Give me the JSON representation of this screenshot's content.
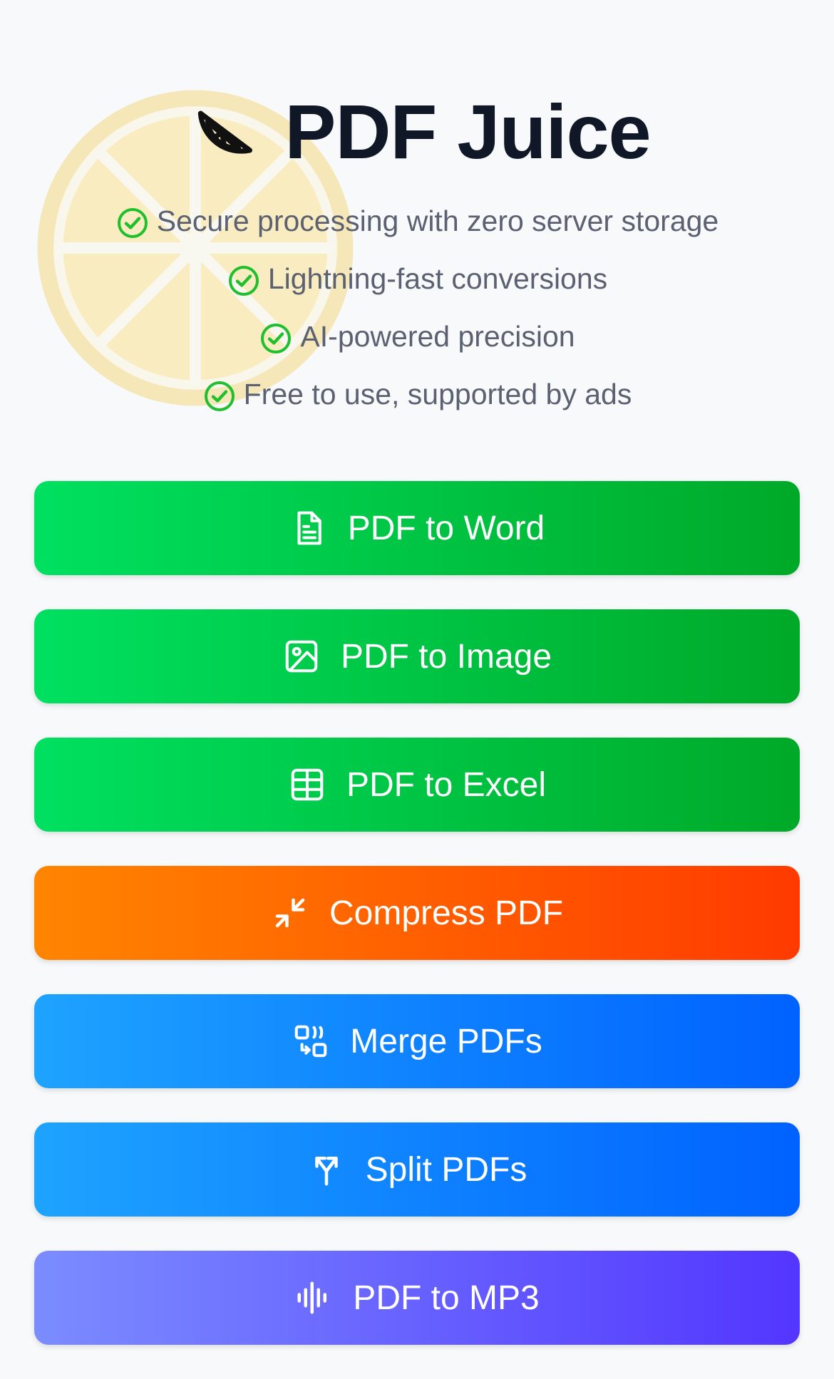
{
  "app": {
    "title": "PDF Juice"
  },
  "features": [
    {
      "icon": "check-circle-icon",
      "text": "Secure processing with zero server storage"
    },
    {
      "icon": "check-circle-icon",
      "text": "Lightning-fast conversions"
    },
    {
      "icon": "check-circle-icon",
      "text": "AI-powered precision"
    },
    {
      "icon": "check-circle-icon",
      "text": "Free to use, supported by ads"
    }
  ],
  "actions": [
    {
      "label": "PDF to Word",
      "icon": "document-icon",
      "color_start": "#00e060",
      "color_end": "#00a928"
    },
    {
      "label": "PDF to Image",
      "icon": "image-icon",
      "color_start": "#00e060",
      "color_end": "#00a928"
    },
    {
      "label": "PDF to Excel",
      "icon": "table-icon",
      "color_start": "#00e060",
      "color_end": "#00a928"
    },
    {
      "label": "Compress PDF",
      "icon": "compress-arrows-icon",
      "color_start": "#ff8500",
      "color_end": "#ff3a00"
    },
    {
      "label": "Merge PDFs",
      "icon": "merge-icon",
      "color_start": "#1ea3ff",
      "color_end": "#0062ff"
    },
    {
      "label": "Split PDFs",
      "icon": "split-icon",
      "color_start": "#1ea3ff",
      "color_end": "#0062ff"
    },
    {
      "label": "PDF to MP3",
      "icon": "audio-waveform-icon",
      "color_start": "#7b8cff",
      "color_end": "#5336ff"
    }
  ],
  "colors": {
    "check": "#1fbf2e",
    "title": "#101828",
    "feature_text": "#5b6170",
    "background": "#f7f9fb"
  }
}
